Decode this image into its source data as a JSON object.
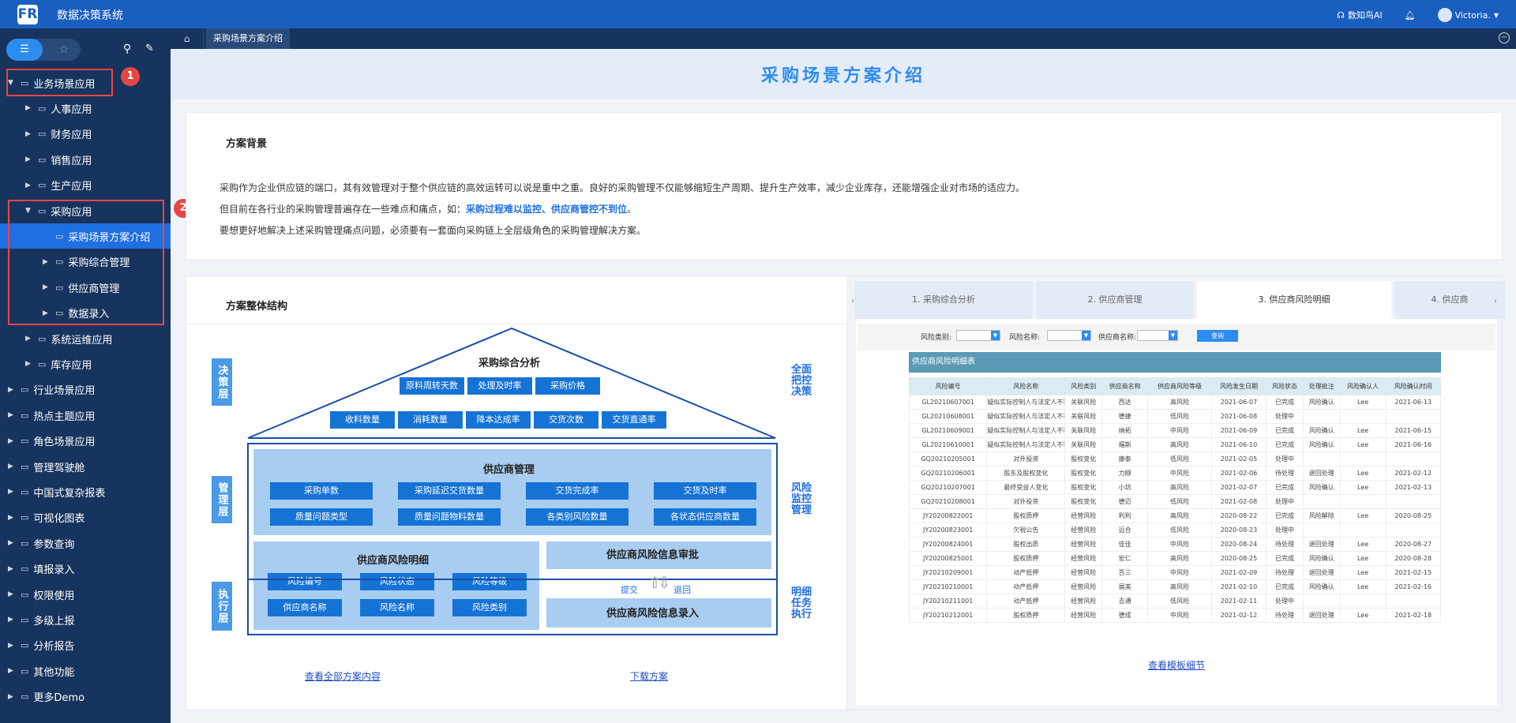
{
  "app": {
    "title": "数据决策系统",
    "logo": "FR",
    "ai": "数知鸟AI",
    "user": "Victoria."
  },
  "sidebar": {
    "items": [
      {
        "label": "业务场景应用",
        "arrow": "▼",
        "level": 0
      },
      {
        "label": "人事应用",
        "arrow": "▶",
        "level": 1
      },
      {
        "label": "财务应用",
        "arrow": "▶",
        "level": 1
      },
      {
        "label": "销售应用",
        "arrow": "▶",
        "level": 1
      },
      {
        "label": "生产应用",
        "arrow": "▶",
        "level": 1
      },
      {
        "label": "采购应用",
        "arrow": "▼",
        "level": 1
      },
      {
        "label": "采购场景方案介绍",
        "arrow": "",
        "level": 2,
        "selected": true
      },
      {
        "label": "采购综合管理",
        "arrow": "▶",
        "level": 2
      },
      {
        "label": "供应商管理",
        "arrow": "▶",
        "level": 2
      },
      {
        "label": "数据录入",
        "arrow": "▶",
        "level": 2
      },
      {
        "label": "系统运维应用",
        "arrow": "▶",
        "level": 1
      },
      {
        "label": "库存应用",
        "arrow": "▶",
        "level": 1
      },
      {
        "label": "行业场景应用",
        "arrow": "▶",
        "level": 0
      },
      {
        "label": "热点主题应用",
        "arrow": "▶",
        "level": 0
      },
      {
        "label": "角色场景应用",
        "arrow": "▶",
        "level": 0
      },
      {
        "label": "管理驾驶舱",
        "arrow": "▶",
        "level": 0
      },
      {
        "label": "中国式复杂报表",
        "arrow": "▶",
        "level": 0
      },
      {
        "label": "可视化图表",
        "arrow": "▶",
        "level": 0
      },
      {
        "label": "参数查询",
        "arrow": "▶",
        "level": 0
      },
      {
        "label": "填报录入",
        "arrow": "▶",
        "level": 0
      },
      {
        "label": "权限使用",
        "arrow": "▶",
        "level": 0
      },
      {
        "label": "多级上报",
        "arrow": "▶",
        "level": 0
      },
      {
        "label": "分析报告",
        "arrow": "▶",
        "level": 0
      },
      {
        "label": "其他功能",
        "arrow": "▶",
        "level": 0
      },
      {
        "label": "更多Demo",
        "arrow": "▶",
        "level": 0
      }
    ],
    "badges": [
      "1",
      "2"
    ]
  },
  "tabs": {
    "active": "采购场景方案介绍"
  },
  "page": {
    "title": "采购场景方案介绍"
  },
  "background": {
    "heading": "方案背景",
    "p1": "采购作为企业供应链的端口，其有效管理对于整个供应链的高效运转可以说是重中之重。良好的采购管理不仅能够缩短生产周期、提升生产效率，减少企业库存，还能增强企业对市场的适应力。",
    "p2a": "但目前在各行业的采购管理普遍存在一些难点和痛点，如：",
    "p2b": "采购过程难以监控、供应商管控不到位",
    "p2c": "。",
    "p3": "要想更好地解决上述采购管理痛点问题，必须要有一套面向采购链上全层级角色的采购管理解决方案。"
  },
  "structure": {
    "heading": "方案整体结构",
    "left_layers": [
      "决策层",
      "管理层",
      "执行层"
    ],
    "right_labels": [
      "全面\n把控\n决策",
      "风险\n监控\n管理",
      "明细\n任务\n执行"
    ],
    "roof": {
      "title": "采购综合分析",
      "row1": [
        "原料周转天数",
        "处理及时率",
        "采购价格"
      ],
      "row2": [
        "收料数量",
        "消耗数量",
        "降本达成率",
        "交货次数",
        "交货直通率"
      ]
    },
    "mgmt": {
      "title": "供应商管理",
      "row1": [
        "采购单数",
        "采购延迟交货数量",
        "交货完成率",
        "交货及时率"
      ],
      "row2": [
        "质量问题类型",
        "质量问题物料数量",
        "各类别风险数量",
        "各状态供应商数量"
      ]
    },
    "risk": {
      "title": "供应商风险明细",
      "row1": [
        "风险编号",
        "风险状态",
        "风险等级"
      ],
      "row2": [
        "供应商名称",
        "风险名称",
        "风险类别"
      ]
    },
    "approve": "供应商风险信息审批",
    "entry": "供应商风险信息录入",
    "submit": "提交",
    "back": "退回",
    "link1": "查看全部方案内容",
    "link2": "下载方案"
  },
  "preview": {
    "tabs": [
      "1. 采购综合分析",
      "2. 供应商管理",
      "3. 供应商风险明细",
      "4. 供应商"
    ],
    "filters": [
      "风险类别:",
      "风险名称:",
      "供应商名称:"
    ],
    "query": "查询",
    "table_title": "供应商风险明细表",
    "columns": [
      "风险编号",
      "风险名称",
      "风险类别",
      "供应商名称",
      "供应商风险等级",
      "风险发生日期",
      "风险状态",
      "处理批注",
      "风险确认人",
      "风险确认时间"
    ],
    "rows": [
      [
        "GL20210607001",
        "疑似实际控制人与法定人不符",
        "关联风险",
        "西达",
        "高风险",
        "2021-06-07",
        "已完成",
        "风险确认",
        "Lee",
        "2021-06-13"
      ],
      [
        "GL20210608001",
        "疑似实际控制人与法定人不符",
        "关联风险",
        "德捷",
        "低风险",
        "2021-06-08",
        "处理中",
        "",
        "",
        ""
      ],
      [
        "GL20210609001",
        "疑似实际控制人与法定人不符",
        "关联风险",
        "纳拓",
        "中风险",
        "2021-06-09",
        "已完成",
        "风险确认",
        "Lee",
        "2021-06-15"
      ],
      [
        "GL20210610001",
        "疑似实际控制人与法定人不符",
        "关联风险",
        "福斯",
        "高风险",
        "2021-06-10",
        "已完成",
        "风险确认",
        "Lee",
        "2021-06-16"
      ],
      [
        "GQ20210205001",
        "对外投资",
        "股权变化",
        "康泰",
        "低风险",
        "2021-02-05",
        "处理中",
        "",
        "",
        ""
      ],
      [
        "GQ20210206001",
        "股东及股权变化",
        "股权变化",
        "力顺",
        "中风险",
        "2021-02-06",
        "待处理",
        "退回处理",
        "Lee",
        "2021-02-12"
      ],
      [
        "GQ20210207001",
        "最终受益人变化",
        "股权变化",
        "小坊",
        "高风险",
        "2021-02-07",
        "已完成",
        "风险确认",
        "Lee",
        "2021-02-13"
      ],
      [
        "GQ20210208001",
        "对外投资",
        "股权变化",
        "德迈",
        "低风险",
        "2021-02-08",
        "处理中",
        "",
        "",
        ""
      ],
      [
        "JY20200822001",
        "股权质押",
        "经营风险",
        "利利",
        "高风险",
        "2020-08-22",
        "已完成",
        "风险解除",
        "Lee",
        "2020-08-25"
      ],
      [
        "JY20200823001",
        "欠税公告",
        "经营风险",
        "远合",
        "低风险",
        "2020-08-23",
        "处理中",
        "",
        "",
        ""
      ],
      [
        "JY20200824001",
        "股权出质",
        "经营风险",
        "佳佳",
        "中风险",
        "2020-08-24",
        "待处理",
        "退回处理",
        "Lee",
        "2020-08-27"
      ],
      [
        "JY20200825001",
        "股权质押",
        "经营风险",
        "宏仁",
        "高风险",
        "2020-08-25",
        "已完成",
        "风险确认",
        "Lee",
        "2020-08-28"
      ],
      [
        "JY20210209001",
        "动产抵押",
        "经营风险",
        "百三",
        "中风险",
        "2021-02-09",
        "待处理",
        "退回处理",
        "Lee",
        "2021-02-15"
      ],
      [
        "JY20210210001",
        "动产抵押",
        "经营风险",
        "展美",
        "高风险",
        "2021-02-10",
        "已完成",
        "风险确认",
        "Lee",
        "2021-02-16"
      ],
      [
        "JY20210211001",
        "动产抵押",
        "经营风险",
        "吉通",
        "低风险",
        "2021-02-11",
        "处理中",
        "",
        "",
        ""
      ],
      [
        "JY20210212001",
        "股权质押",
        "经营风险",
        "德成",
        "中风险",
        "2021-02-12",
        "待处理",
        "退回处理",
        "Lee",
        "2021-02-18"
      ]
    ],
    "link": "查看模板细节"
  }
}
